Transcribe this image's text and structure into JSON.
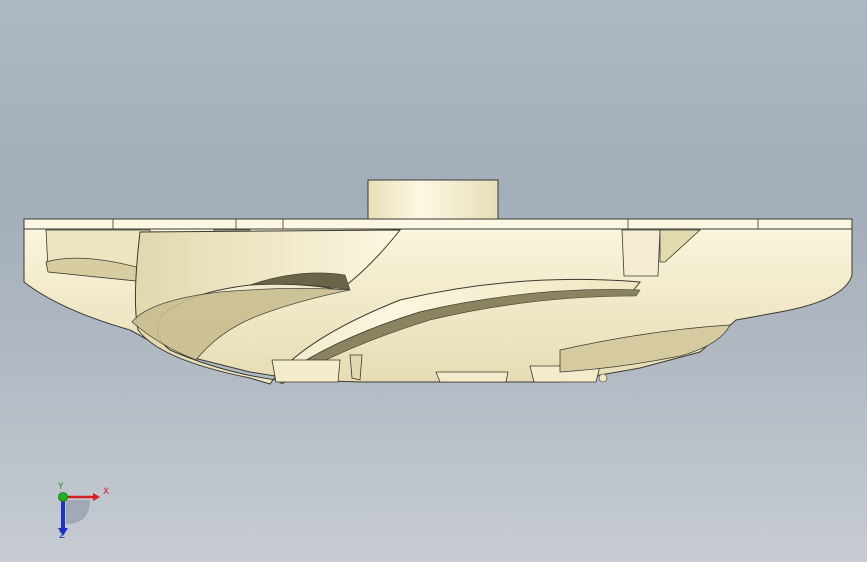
{
  "viewport": {
    "background_top": "#aeb8c4",
    "background_bottom": "#c7ccd3"
  },
  "model": {
    "part": "impeller",
    "face_color": "#f7f1d6",
    "shadow_color": "#d8cfa8",
    "edge_color": "#3a3a32"
  },
  "triad": {
    "x_label": "X",
    "y_label": "Y",
    "z_label": "Z",
    "x_color": "#d02020",
    "y_color": "#20a020",
    "z_color": "#2030c0"
  }
}
